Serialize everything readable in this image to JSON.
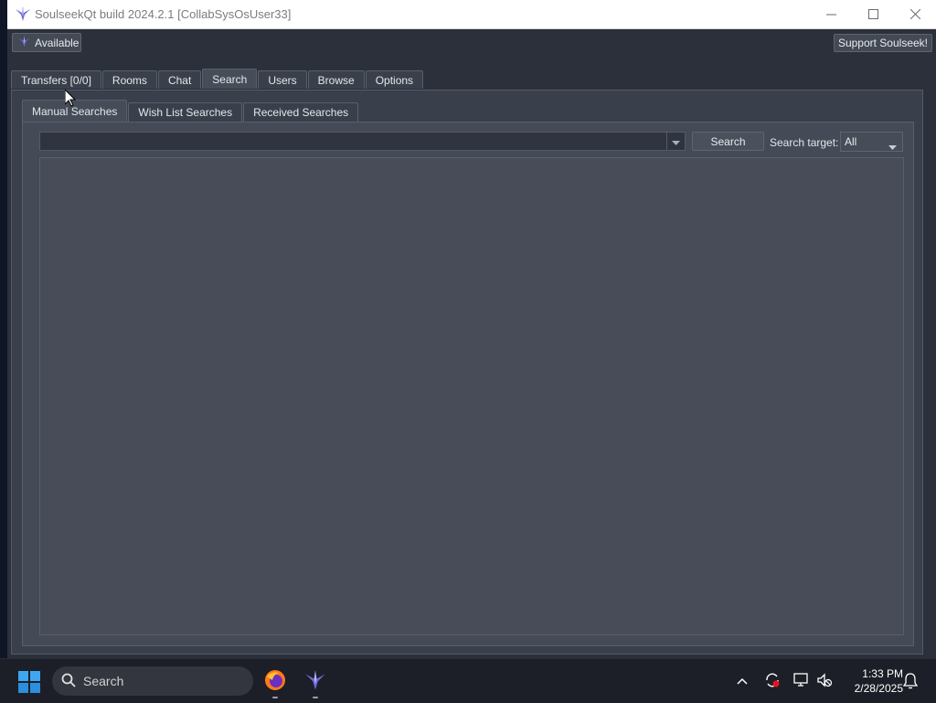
{
  "window": {
    "title": "SoulseekQt build 2024.2.1 [CollabSysOsUser33]",
    "minimize_icon": "minimize-icon",
    "maximize_icon": "maximize-icon",
    "close_icon": "close-icon"
  },
  "toolbar": {
    "status_label": "Available",
    "status_icon": "soulseek-bird-icon",
    "support_label": "Support Soulseek!"
  },
  "main_tabs": [
    {
      "label": "Transfers [0/0]",
      "active": false
    },
    {
      "label": "Rooms",
      "active": false
    },
    {
      "label": "Chat",
      "active": false
    },
    {
      "label": "Search",
      "active": true
    },
    {
      "label": "Users",
      "active": false
    },
    {
      "label": "Browse",
      "active": false
    },
    {
      "label": "Options",
      "active": false
    }
  ],
  "sub_tabs": [
    {
      "label": "Manual Searches",
      "active": true
    },
    {
      "label": "Wish List Searches",
      "active": false
    },
    {
      "label": "Received Searches",
      "active": false
    }
  ],
  "search": {
    "query_value": "",
    "button_label": "Search",
    "target_label": "Search target:",
    "target_value": "All"
  },
  "taskbar": {
    "search_label": "Search",
    "apps": [
      "firefox-icon",
      "soulseek-icon"
    ],
    "tray": [
      "chevron-up-icon",
      "sync-icon",
      "network-icon",
      "volume-muted-icon"
    ],
    "time": "1:33 PM",
    "date": "2/28/2025"
  },
  "colors": {
    "window_bg": "#2b303a",
    "pane_bg": "#444a56",
    "text": "#e4e6ea",
    "accent_bird": "#6f6ad8"
  }
}
